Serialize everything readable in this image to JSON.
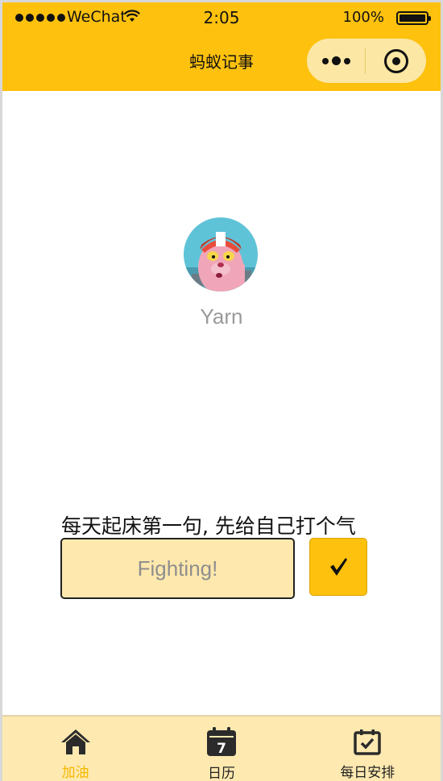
{
  "status_bar": {
    "carrier": "WeChat",
    "time": "2:05",
    "battery": "100%"
  },
  "nav": {
    "title": "蚂蚁记事",
    "more_icon": "more-dots-icon",
    "close_icon": "target-circle-icon"
  },
  "profile": {
    "username": "Yarn",
    "avatar_icon": "pink-panther-avatar"
  },
  "motto": {
    "text": "每天起床第一句, 先给自己打个气",
    "input_placeholder": "Fighting!",
    "confirm_icon": "checkmark-icon"
  },
  "tabbar": {
    "tabs": [
      {
        "label": "加油",
        "icon": "home-icon",
        "active": true
      },
      {
        "label": "日历",
        "icon": "calendar-icon",
        "badge": "7",
        "active": false
      },
      {
        "label": "每日安排",
        "icon": "calendar-check-icon",
        "active": false
      }
    ]
  },
  "colors": {
    "primary": "#fdc10e",
    "input_bg": "#fee8ad",
    "tabbar_bg": "#fee9b0",
    "active_tab": "#f5b800"
  }
}
